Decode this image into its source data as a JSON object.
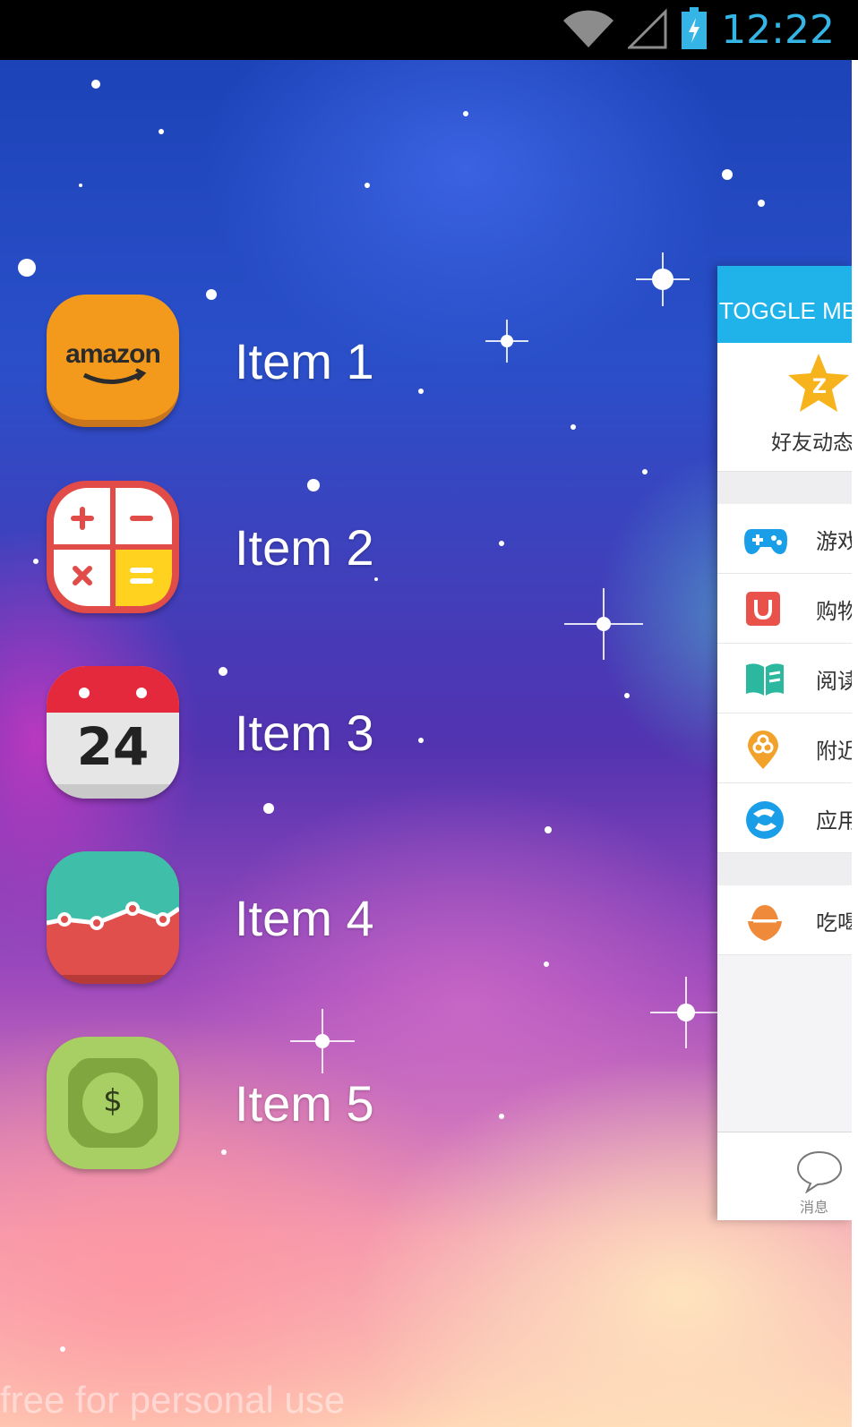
{
  "status_bar": {
    "time": "12:22",
    "time_color": "#35b5e5",
    "icons": [
      "wifi-icon",
      "signal-icon",
      "battery-charging-icon"
    ]
  },
  "menu": {
    "items": [
      {
        "label": "Item 1",
        "icon": "amazon-icon",
        "icon_text": "amazon"
      },
      {
        "label": "Item 2",
        "icon": "calculator-icon"
      },
      {
        "label": "Item 3",
        "icon": "calendar-icon",
        "icon_text": "24"
      },
      {
        "label": "Item 4",
        "icon": "chart-icon"
      },
      {
        "label": "Item 5",
        "icon": "money-icon",
        "icon_text": "$"
      }
    ]
  },
  "panel": {
    "header_title": "TOGGLE ME",
    "header_color": "#1fb3ea",
    "feed_label": "好友动态",
    "rows_group1": [
      {
        "label": "游戏",
        "icon": "gamepad-icon",
        "color": "#1a9ee8"
      },
      {
        "label": "购物",
        "icon": "shopping-bag-icon",
        "color": "#e9524a"
      },
      {
        "label": "阅读",
        "icon": "book-icon",
        "color": "#2bb89e"
      },
      {
        "label": "附近",
        "icon": "location-icon",
        "color": "#f2a22a"
      },
      {
        "label": "应用",
        "icon": "app-icon",
        "color": "#1a9ee8"
      }
    ],
    "rows_group2": [
      {
        "label": "吃喝",
        "icon": "food-icon",
        "color": "#f08a3b"
      }
    ],
    "bottom_tab_label": "消息"
  },
  "watermark": "free for personal use"
}
